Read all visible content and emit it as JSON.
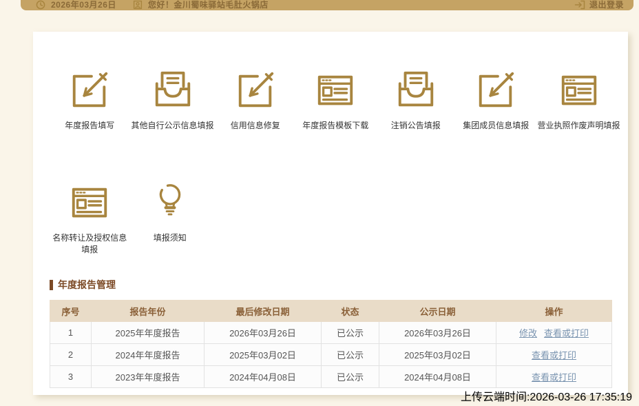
{
  "topbar": {
    "date": "2026年03月26日",
    "greeting": "您好！金川蜀味驿站毛肚火锅店",
    "logout_label": "退出登录",
    "icons": {
      "left1": "clock-icon",
      "left2": "user-badge-icon",
      "right": "logout-icon"
    }
  },
  "colors": {
    "topbar_bg": "#c5a364",
    "topbar_text": "#8a6a38",
    "page_bg": "#faf5e9",
    "icon_gold": "#a8853f",
    "section_title": "#7c4a26",
    "table_header_bg": "#e9dcc8",
    "table_header_text": "#8a6038",
    "link": "#7a94b0"
  },
  "menu": {
    "items": [
      {
        "label": "年度报告填写",
        "icon": "edit-icon"
      },
      {
        "label": "其他自行公示信息填报",
        "icon": "inbox-icon"
      },
      {
        "label": "信用信息修复",
        "icon": "edit-icon"
      },
      {
        "label": "年度报告模板下载",
        "icon": "template-icon"
      },
      {
        "label": "注销公告填报",
        "icon": "inbox-icon"
      },
      {
        "label": "集团成员信息填报",
        "icon": "edit-icon"
      },
      {
        "label": "营业执照作废声明填报",
        "icon": "template-icon"
      },
      {
        "label": "名称转让及授权信息填报",
        "icon": "template-icon"
      },
      {
        "label": "填报须知",
        "icon": "bulb-icon"
      }
    ]
  },
  "section": {
    "title": "年度报告管理"
  },
  "table": {
    "headers": [
      "序号",
      "报告年份",
      "最后修改日期",
      "状态",
      "公示日期",
      "操作"
    ],
    "rows": [
      {
        "index": "1",
        "year": "2025年年度报告",
        "modified": "2026年03月26日",
        "status": "已公示",
        "publish": "2026年03月26日",
        "actions": [
          "修改",
          "查看或打印"
        ]
      },
      {
        "index": "2",
        "year": "2024年年度报告",
        "modified": "2025年03月02日",
        "status": "已公示",
        "publish": "2025年03月02日",
        "actions": [
          "查看或打印"
        ]
      },
      {
        "index": "3",
        "year": "2023年年度报告",
        "modified": "2024年04月08日",
        "status": "已公示",
        "publish": "2024年04月08日",
        "actions": [
          "查看或打印"
        ]
      }
    ]
  },
  "footer": {
    "upload_time": "上传云端时间:2026-03-26 17:35:19"
  }
}
